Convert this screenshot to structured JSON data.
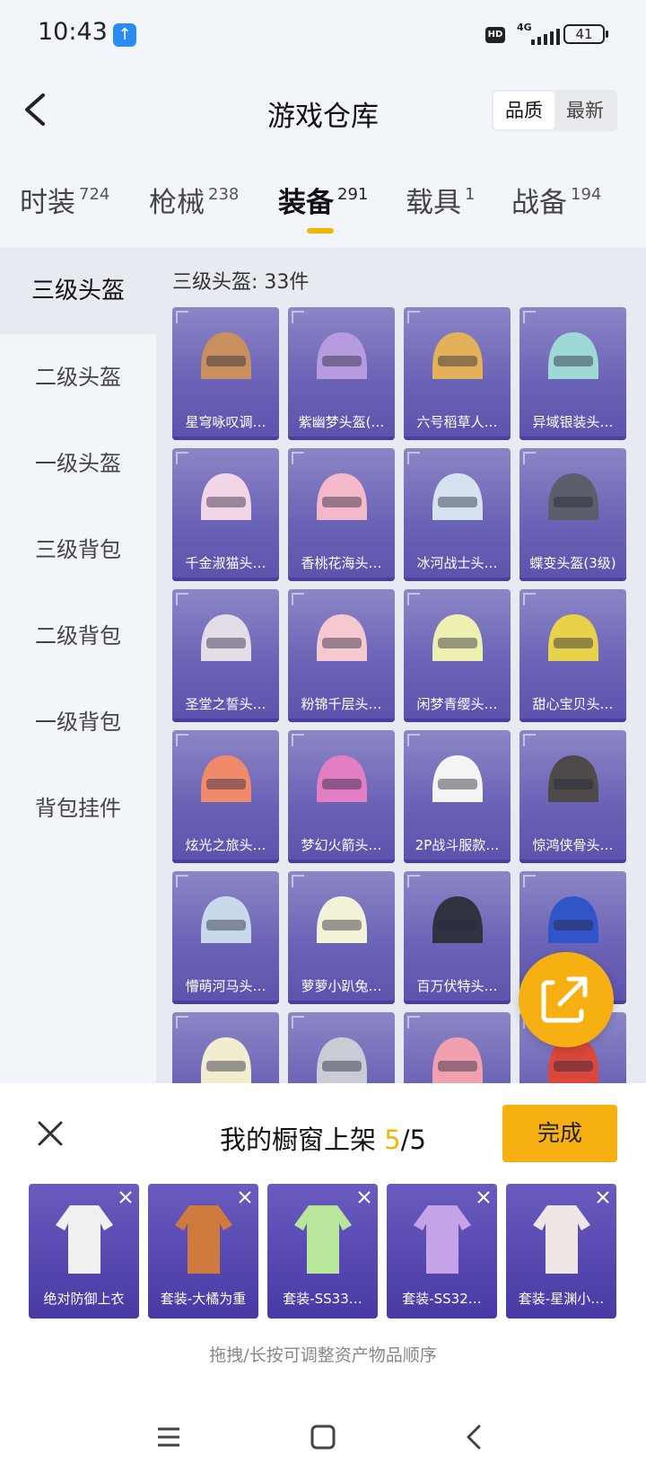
{
  "status": {
    "time": "10:43",
    "network": "4G",
    "hd": "HD",
    "battery": "41"
  },
  "header": {
    "title": "游戏仓库",
    "sort": [
      "品质",
      "最新"
    ]
  },
  "categories": [
    {
      "label": "时装",
      "count": "724"
    },
    {
      "label": "枪械",
      "count": "238"
    },
    {
      "label": "装备",
      "count": "291"
    },
    {
      "label": "载具",
      "count": "1"
    },
    {
      "label": "战备",
      "count": "194"
    }
  ],
  "sidebar": [
    "三级头盔",
    "二级头盔",
    "一级头盔",
    "三级背包",
    "二级背包",
    "一级背包",
    "背包挂件"
  ],
  "main": {
    "count_text": "三级头盔: 33件",
    "items": [
      {
        "name": "星穹咏叹调…",
        "color": "#c98f5e"
      },
      {
        "name": "紫幽梦头盔(…",
        "color": "#b79be0"
      },
      {
        "name": "六号稻草人…",
        "color": "#e2b15a"
      },
      {
        "name": "异域银装头…",
        "color": "#9fd9d6"
      },
      {
        "name": "千金淑猫头…",
        "color": "#f3d6e6"
      },
      {
        "name": "香桃花海头…",
        "color": "#f4b9c8"
      },
      {
        "name": "冰河战士头…",
        "color": "#d6e2f0"
      },
      {
        "name": "蝶变头盔(3级)",
        "color": "#5a5f6a"
      },
      {
        "name": "圣堂之誓头…",
        "color": "#e4dde8"
      },
      {
        "name": "粉锦千层头…",
        "color": "#f6c8cf"
      },
      {
        "name": "闲梦青缨头…",
        "color": "#eef0b2"
      },
      {
        "name": "甜心宝贝头…",
        "color": "#e7d24a"
      },
      {
        "name": "炫光之旅头…",
        "color": "#f08a6a"
      },
      {
        "name": "梦幻火箭头…",
        "color": "#e27fc4"
      },
      {
        "name": "2P战斗服款…",
        "color": "#f4f4f4"
      },
      {
        "name": "惊鸿侠骨头…",
        "color": "#4e4a4a"
      },
      {
        "name": "懵萌河马头…",
        "color": "#c8d9ec"
      },
      {
        "name": "萝萝小趴兔…",
        "color": "#f2f3d6"
      },
      {
        "name": "百万伏特头…",
        "color": "#2f3340"
      },
      {
        "name": "",
        "color": "#2f55c8"
      },
      {
        "name": "",
        "color": "#f2ecd0"
      },
      {
        "name": "",
        "color": "#c9ccd4"
      },
      {
        "name": "",
        "color": "#f1a0ad"
      },
      {
        "name": "",
        "color": "#d9483a"
      }
    ]
  },
  "panel": {
    "title_prefix": "我的橱窗上架 ",
    "title_current": "5",
    "title_suffix": "/5",
    "done": "完成",
    "hint": "拖拽/长按可调整资产物品顺序",
    "items": [
      {
        "name": "绝对防御上衣",
        "color": "#f0f0f0"
      },
      {
        "name": "套装-大橘为重",
        "color": "#d07a3e"
      },
      {
        "name": "套装-SS33…",
        "color": "#b9e69a"
      },
      {
        "name": "套装-SS32…",
        "color": "#c6a3e8"
      },
      {
        "name": "套装-星渊小…",
        "color": "#efe6e6"
      }
    ]
  }
}
